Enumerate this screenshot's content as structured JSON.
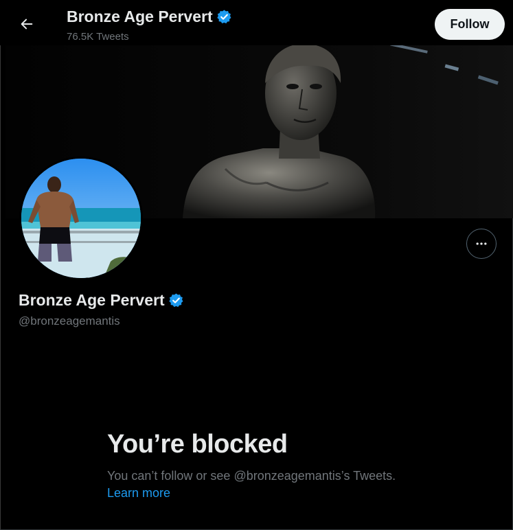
{
  "header": {
    "back_label": "Back",
    "display_name": "Bronze Age Pervert",
    "tweet_count": "76.5K Tweets",
    "follow_label": "Follow"
  },
  "profile": {
    "display_name": "Bronze Age Pervert",
    "handle": "@bronzeagemantis",
    "verified": true
  },
  "blocked": {
    "title": "You’re blocked",
    "description": "You can’t follow or see @bronzeagemantis’s Tweets.",
    "learn_more": "Learn more"
  },
  "colors": {
    "background": "#000000",
    "accent": "#1d9bf0",
    "text_primary": "#e7e9ea",
    "text_secondary": "#71767b"
  },
  "icons": {
    "back": "arrow-left-icon",
    "verified": "verified-badge-icon",
    "more": "more-horizontal-icon"
  }
}
